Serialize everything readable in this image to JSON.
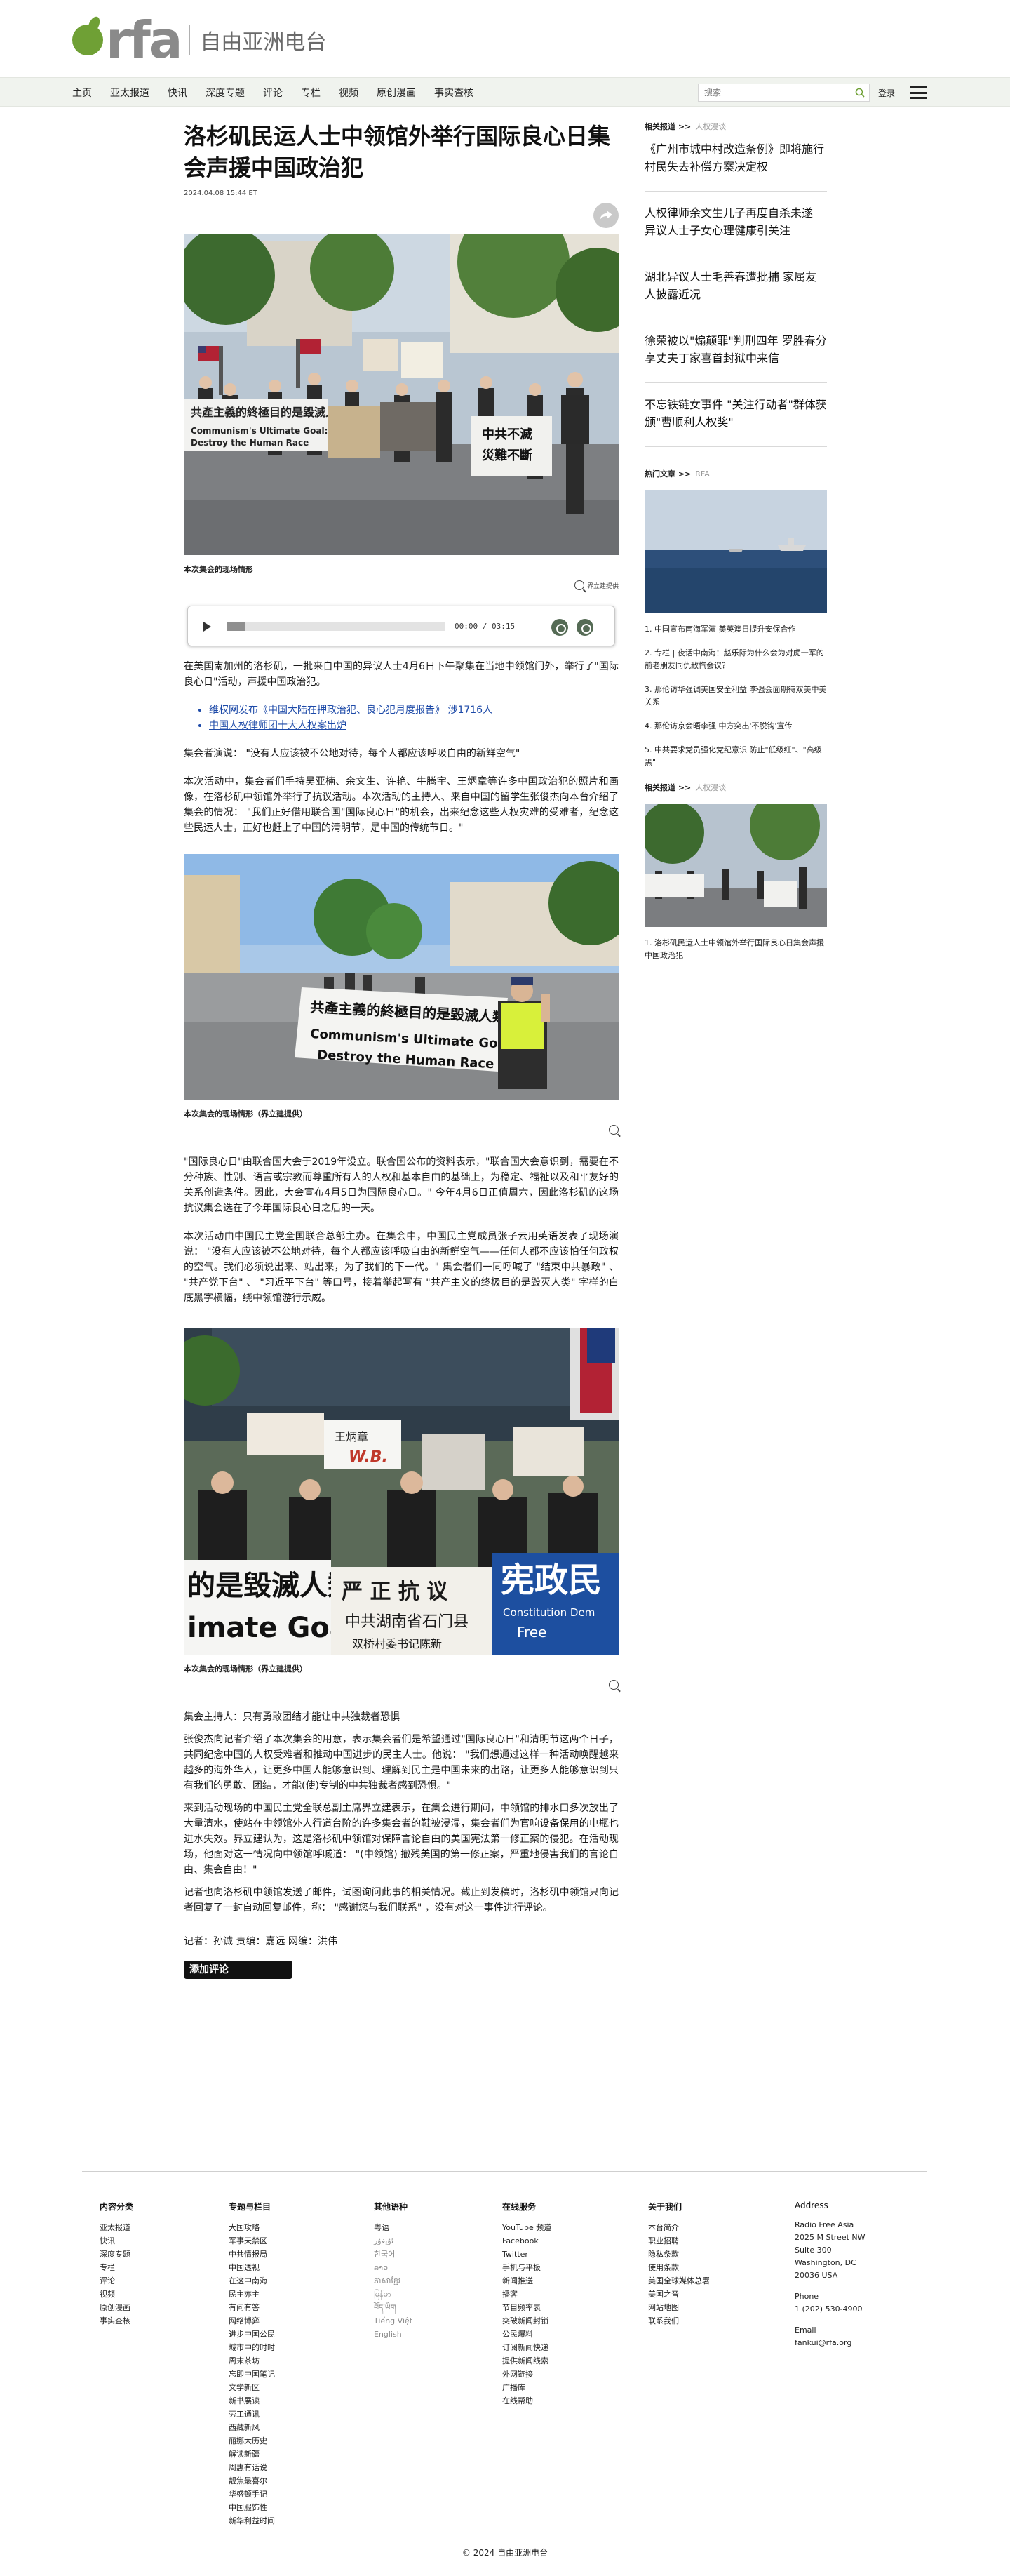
{
  "brand": {
    "logo_text": "rfa",
    "name_cn": "自由亚洲电台"
  },
  "nav": {
    "items": [
      "主页",
      "亚太报道",
      "快讯",
      "深度专题",
      "评论",
      "专栏",
      "视频",
      "原创漫画",
      "事实查核"
    ],
    "search_placeholder": "搜索",
    "login_label": "登录"
  },
  "article": {
    "headline": "洛杉矶民运人士中领馆外举行国际良心日集会声援中国政治犯",
    "dateline": "2024.04.08 15:44 ET",
    "photo1_caption": "本次集会的现场情形",
    "enlarge_label": "界立建提供",
    "audio": {
      "time": "00:00 / 03:15",
      "progress": 0.08
    },
    "p1": "在美国南加州的洛杉矶，一批来自中国的异议人士4月6日下午聚集在当地中领馆门外，举行了\"国际良心日\"活动，声援中国政治犯。",
    "links": [
      "维权网发布《中国大陆在押政治犯、良心犯月度报告》 涉1716人",
      "中国人权律师团十大人权案出炉"
    ],
    "p2": "集会者演说：  \"没有人应该被不公地对待，每个人都应该呼吸自由的新鲜空气\"",
    "p3": "本次活动中，集会者们手持吴亚楠、余文生、许艳、牛腾宇、王炳章等许多中国政治犯的照片和画像，在洛杉矶中领馆外举行了抗议活动。本次活动的主持人、来自中国的留学生张俊杰向本台介绍了集会的情况：  \"我们正好借用联合国\"国际良心日\"的机会，出来纪念这些人权灾难的受难者，纪念这些民运人士，正好也赶上了中国的清明节，是中国的传统节日。\"",
    "photo2_caption": "本次集会的现场情形（界立建提供）",
    "p4": "\"国际良心日\"由联合国大会于2019年设立。联合国公布的资料表示，\"联合国大会意识到，需要在不分种族、性别、语言或宗教而尊重所有人的人权和基本自由的基础上，为稳定、福祉以及和平友好的关系创造条件。因此，大会宣布4月5日为国际良心日。\" 今年4月6日正值周六，因此洛杉矶的这场抗议集会选在了今年国际良心日之后的一天。",
    "p5": "本次活动由中国民主党全国联合总部主办。在集会中，中国民主党成员张子云用英语发表了现场演说：  \"没有人应该被不公地对待，每个人都应该呼吸自由的新鲜空气——任何人都不应该怕任何政权的空气。我们必须说出来、站出来，为了我们的下一代。\" 集会者们一同呼喊了 \"结束中共暴政\" 、 \"共产党下台\" 、 \"习近平下台\" 等口号，接着举起写有 \"共产主义的终极目的是毁灭人类\" 字样的白底黑字横幅，绕中领馆游行示威。",
    "photo3_caption": "本次集会的现场情形（界立建提供）",
    "p6": "集会主持人：只有勇敢团结才能让中共独裁者恐惧",
    "p7": "张俊杰向记者介绍了本次集会的用意，表示集会者们是希望通过\"国际良心日\"和清明节这两个日子，共同纪念中国的人权受难者和推动中国进步的民主人士。他说：  \"我们想通过这样一种活动唤醒越来越多的海外华人，让更多中国人能够意识到、理解到民主是中国未来的出路，让更多人能够意识到只有我们的勇敢、团结，才能(使)专制的中共独裁者感到恐惧。\"",
    "p8": "来到活动现场的中国民主党全联总副主席界立建表示，在集会进行期间，中领馆的排水口多次放出了大量清水，使站在中领馆外人行道台阶的许多集会者的鞋被浸湿，集会者们为官响设备保用的电瓶也进水失效。界立建认为，这是洛杉矶中领馆对保障言论自由的美国宪法第一修正案的侵犯。在活动现场，他面对这一情况向中领馆呼喊道：  \"(中领馆) 撤残美国的第一修正案，严重地侵害我们的言论自由、集会自由！\"",
    "p9": "记者也向洛杉矶中领馆发送了邮件，试图询问此事的相关情况。截止到发稿时，洛杉矶中领馆只向记者回复了一封自动回复邮件，称：  \"感谢您与我们联系\" ，没有对这一事件进行评论。",
    "byline": "记者：孙诚    责编：嘉远    网编：洪伟",
    "comment_label": "添加评论",
    "banner_text_1": "共產主義的終極目的是毀滅人類",
    "banner_text_2": "Communism's Ultimate Goal: Destroy the Human Race",
    "banner_text_3": "中共不滅 災難不斷",
    "banner_text_4": "严 正 抗 议",
    "banner_text_5": "中共湖南省石门县",
    "banner_text_6": "宪政民",
    "banner_text_7": "Constitution Democracy Free"
  },
  "sidebar": {
    "related_head": "相关报道 >>",
    "related_sub": "人权漫谈",
    "related": [
      "《广州市城中村改造条例》即将施行  村民失去补偿方案决定权",
      "人权律师余文生儿子再度自杀未遂  异议人士子女心理健康引关注",
      "湖北异议人士毛善春遭批捕  家属友人披露近况",
      "徐荣被以\"煽颠罪\"判刑四年  罗胜春分享丈夫丁家喜首封狱中来信",
      "不忘铁链女事件  \"关注行动者\"群体获颁\"曹顺利人权奖\""
    ],
    "hot_head": "热门文章 >>",
    "hot_sub": "RFA",
    "hot": [
      "1. 中国宣布南海军演 美英澳日提升安保合作",
      "2. 专栏 | 夜话中南海：赵乐际为什么会为对虎一军的前老朋友同仇敌忾会议？",
      "3. 那伦访华强调美国安全利益  李强会面期待双美中美关系",
      "4. 那伦访京会晤李强  中方突出'不脱钩'宣传",
      "5. 中共要求党员强化党纪意识  防止\"低级红\"、\"高级黑\""
    ],
    "related2_head": "相关报道 >>",
    "related2_sub": "人权漫谈",
    "related2": [
      "1. 洛杉矶民运人士中领馆外举行国际良心日集会声援中国政治犯"
    ]
  },
  "footer": {
    "cols": [
      {
        "head": "内容分类",
        "items": [
          "亚太报道",
          "快讯",
          "深度专题",
          "专栏",
          "评论",
          "视频",
          "原创漫画",
          "事实查核"
        ]
      },
      {
        "head": "专题与栏目",
        "items": [
          "大国攻略",
          "军事天禁区",
          "中共情报局",
          "中国透视",
          "在这中南海",
          "民主亦主",
          "有问有答",
          "网络博弈",
          "进步中国公民",
          "城市中的时时",
          "周末茶坊",
          "忘即中国笔记",
          "文学新区",
          "新书展读",
          "劳工通讯",
          "西藏新风",
          "丽娜大历史",
          "解读新疆",
          "周惠有话说",
          "靓焦最喜尔",
          "华盛顿手记",
          "中国服饰性",
          "新华利益时间"
        ]
      },
      {
        "head": "其他语种",
        "items": [
          "粤语",
          "ئۇيغۇر",
          "한국어",
          "ລາວ",
          "ភាសាខ្មែរ",
          "မြန်မာ",
          "བོད་ཡིག",
          "Tiếng Việt",
          "English"
        ]
      },
      {
        "head": "在线服务",
        "items": [
          "YouTube 频道",
          "Facebook",
          "Twitter",
          "手机与平板",
          "新闻推送",
          "播客",
          "节目频率表",
          "突破新闻封锁",
          "公民爆料",
          "订阅新闻快递",
          "提供新闻线索",
          "外网链接",
          "广播库",
          "在线帮助"
        ]
      },
      {
        "head": "关于我们",
        "items": [
          "本台简介",
          "职业招聘",
          "隐私条款",
          "使用条款",
          "美国全球媒体总署",
          "美国之音",
          "网站地图",
          "联系我们"
        ]
      }
    ],
    "address": {
      "head": "Address",
      "lines": [
        "Radio Free Asia",
        "2025 M Street NW",
        "Suite 300",
        "Washington, DC",
        "20036 USA"
      ],
      "phone_head": "Phone",
      "phone": "1 (202) 530-4900",
      "email_head": "Email",
      "email": "fankui@rfa.org"
    },
    "copyright": "© 2024 自由亚洲电台"
  }
}
